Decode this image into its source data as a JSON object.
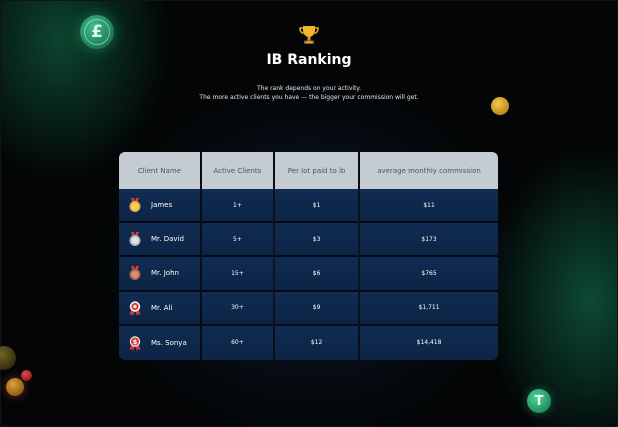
{
  "page": {
    "title": "IB Ranking",
    "subtitle_line1": "The rank depends on your activity.",
    "subtitle_line2": "The more active clients you have — the bigger your commission will get."
  },
  "icons": {
    "trophy": "trophy-icon",
    "pound_coin": "£",
    "gold_coin": "coin-icon",
    "tether_coin": "T"
  },
  "colors": {
    "header_bg": "#c5cbd2",
    "row_bg": "#0f2a4e",
    "gold": "#e8b23a",
    "silver": "#c9ccd2",
    "bronze": "#c97a5a",
    "red": "#d93b3b",
    "green_glow": "#1f8a5c"
  },
  "table": {
    "headers": [
      "Client Name",
      "Active Clients",
      "Per lot paid to ib",
      "average monthly commission"
    ],
    "rows": [
      {
        "name": "James",
        "medal": "gold-medal-icon",
        "active": "1+",
        "per_lot": "$1",
        "commission": "$11"
      },
      {
        "name": "Mr. David",
        "medal": "silver-medal-icon",
        "active": "5+",
        "per_lot": "$3",
        "commission": "$173"
      },
      {
        "name": "Mr. John",
        "medal": "bronze-medal-icon",
        "active": "15+",
        "per_lot": "$6",
        "commission": "$765"
      },
      {
        "name": "Mr. Ali",
        "medal": "ribbon-medal-icon",
        "active": "30+",
        "per_lot": "$9",
        "commission": "$1,711"
      },
      {
        "name": "Ms. Sonya",
        "medal": "dollar-medal-icon",
        "active": "60+",
        "per_lot": "$12",
        "commission": "$14,418"
      }
    ]
  }
}
